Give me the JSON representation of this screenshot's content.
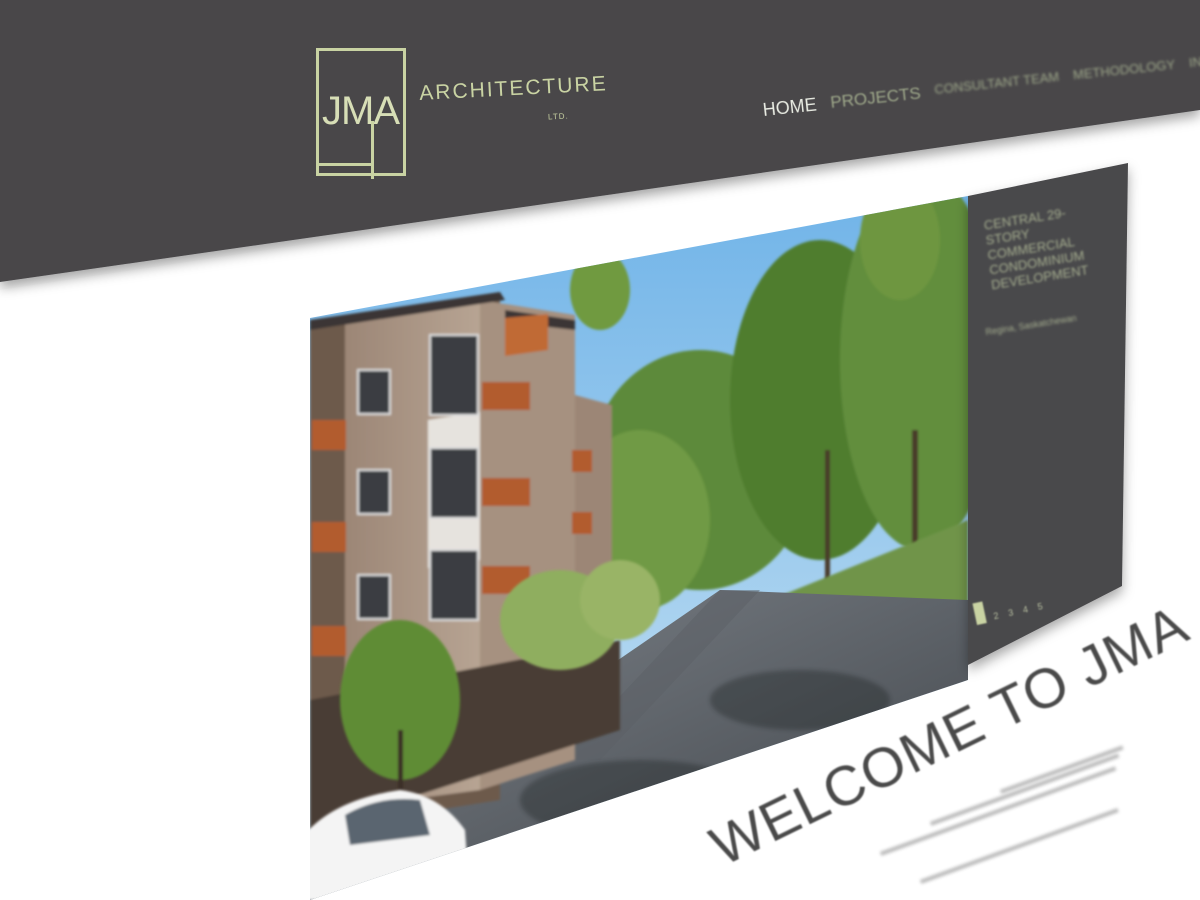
{
  "brand": {
    "monogram": "JMA",
    "name": "ARCHITECTURE",
    "suffix": "LTD.",
    "accent_color": "#c9d3a3",
    "header_color": "#48474a"
  },
  "nav": {
    "items": [
      {
        "label": "HOME",
        "active": true
      },
      {
        "label": "PROJECTS",
        "active": false
      },
      {
        "label": "CONSULTANT TEAM",
        "active": false
      },
      {
        "label": "METHODOLOGY",
        "active": false
      },
      {
        "label": "INQUIRE",
        "active": false
      }
    ]
  },
  "hero": {
    "caption_title": "CENTRAL 29-STORY COMMERCIAL CONDOMINIUM DEVELOPMENT",
    "caption_sub": "Regina, Saskatchewan",
    "slider": {
      "dots": [
        "1",
        "2",
        "3",
        "4",
        "5"
      ],
      "active_index": 0
    }
  },
  "welcome": {
    "heading": "WELCOME TO JMA"
  }
}
